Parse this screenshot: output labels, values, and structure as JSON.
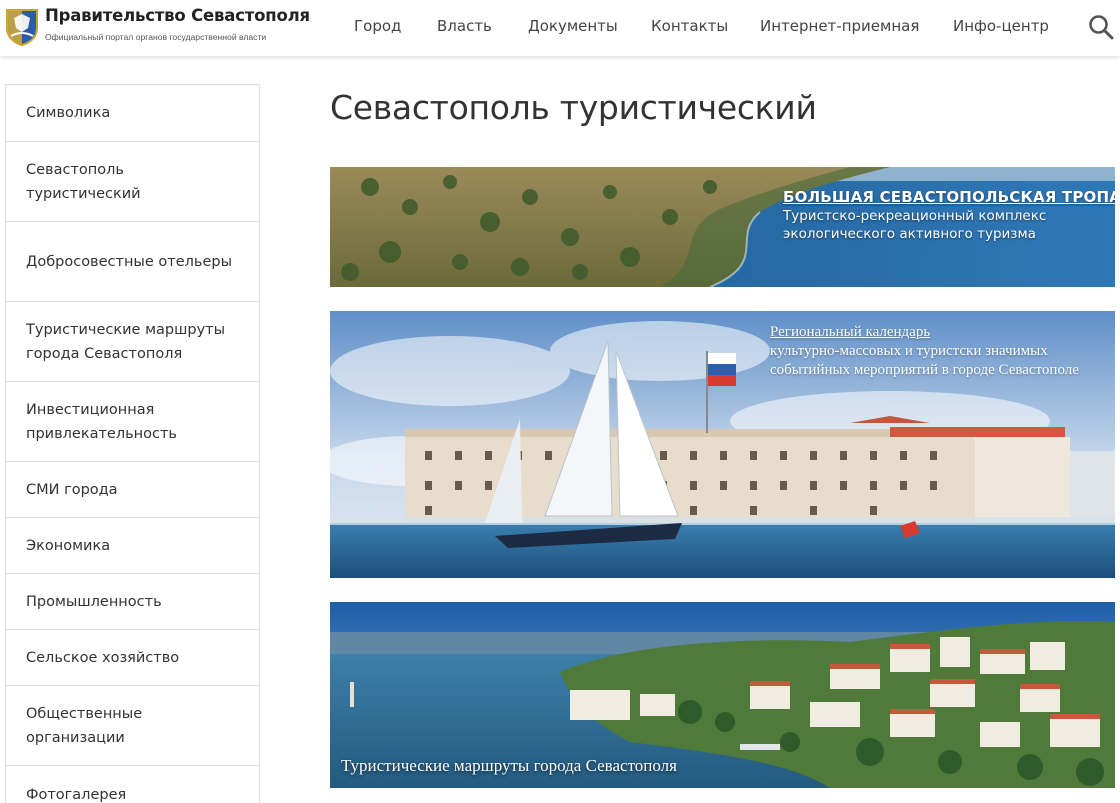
{
  "header": {
    "title": "Правительство Севастополя",
    "subtitle": "Официальный портал органов государственной власти",
    "nav": [
      "Город",
      "Власть",
      "Документы",
      "Контакты",
      "Интернет-приемная",
      "Инфо-центр"
    ]
  },
  "sidebar": {
    "items": [
      "Символика",
      "Севастополь туристический",
      "Добросовестные отельеры",
      "Туристические маршруты города Севастополя",
      "Инвестиционная привлекательность",
      "СМИ города",
      "Экономика",
      "Промышленность",
      "Сельское хозяйство",
      "Общественные организации",
      "Фотогалерея"
    ]
  },
  "main": {
    "title": "Севастополь туристический",
    "banners": [
      {
        "title": "БОЛЬШАЯ СЕВАСТОПОЛЬСКАЯ ТРОПА",
        "line1": "Туристско-рекреационный комплекс",
        "line2": "экологического активного туризма"
      },
      {
        "link": "Региональный календарь",
        "text": "культурно-массовых и туристски значимых событийных мероприятий в городе Севастополе"
      },
      {
        "caption": "Туристические маршруты города Севастополя"
      }
    ]
  },
  "colors": {
    "accent": "#cc3a2b",
    "sea": "#2a6fa5",
    "sky": "#6f9ed2",
    "text": "#333333"
  }
}
